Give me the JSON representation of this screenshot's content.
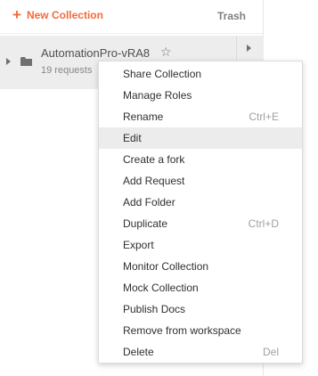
{
  "sidebar": {
    "new_collection_label": "New Collection",
    "trash_label": "Trash",
    "collection": {
      "name": "AutomationPro-vRA8",
      "meta": "19 requests",
      "star_icon": "☆"
    }
  },
  "context_menu": {
    "highlighted_item": "Edit",
    "items": [
      {
        "label": "Share Collection",
        "shortcut": ""
      },
      {
        "label": "Manage Roles",
        "shortcut": ""
      },
      {
        "label": "Rename",
        "shortcut": "Ctrl+E"
      },
      {
        "label": "Edit",
        "shortcut": ""
      },
      {
        "label": "Create a fork",
        "shortcut": ""
      },
      {
        "label": "Add Request",
        "shortcut": ""
      },
      {
        "label": "Add Folder",
        "shortcut": ""
      },
      {
        "label": "Duplicate",
        "shortcut": "Ctrl+D"
      },
      {
        "label": "Export",
        "shortcut": ""
      },
      {
        "label": "Monitor Collection",
        "shortcut": ""
      },
      {
        "label": "Mock Collection",
        "shortcut": ""
      },
      {
        "label": "Publish Docs",
        "shortcut": ""
      },
      {
        "label": "Remove from workspace",
        "shortcut": ""
      },
      {
        "label": "Delete",
        "shortcut": "Del"
      }
    ]
  },
  "colors": {
    "accent": "#f26b3a",
    "row_background": "#ededed",
    "menu_highlight": "#ececec",
    "shortcut_text": "#a0a0a0"
  },
  "icons": {
    "new_collection": "plus-icon",
    "collection_toggle": "caret-right-icon",
    "collection_type": "folder-icon",
    "favorite": "star-icon",
    "row_expand": "chevron-right-icon"
  }
}
